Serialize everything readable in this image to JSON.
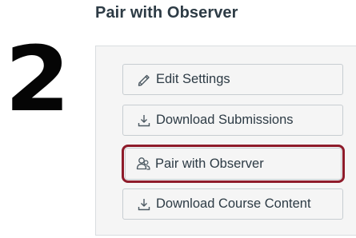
{
  "page": {
    "title": "Pair with Observer"
  },
  "step": {
    "number": "2"
  },
  "actions": {
    "edit_settings": "Edit Settings",
    "download_submissions": "Download Submissions",
    "pair_with_observer": "Pair with Observer",
    "download_course_content": "Download Course Content"
  },
  "colors": {
    "highlight_border": "#8e1b2a",
    "button_text": "#2d3b45",
    "button_background": "#f5f5f5"
  },
  "icons": {
    "edit_settings": "pencil-icon",
    "download_submissions": "download-icon",
    "pair_with_observer": "users-icon",
    "download_course_content": "download-icon"
  }
}
